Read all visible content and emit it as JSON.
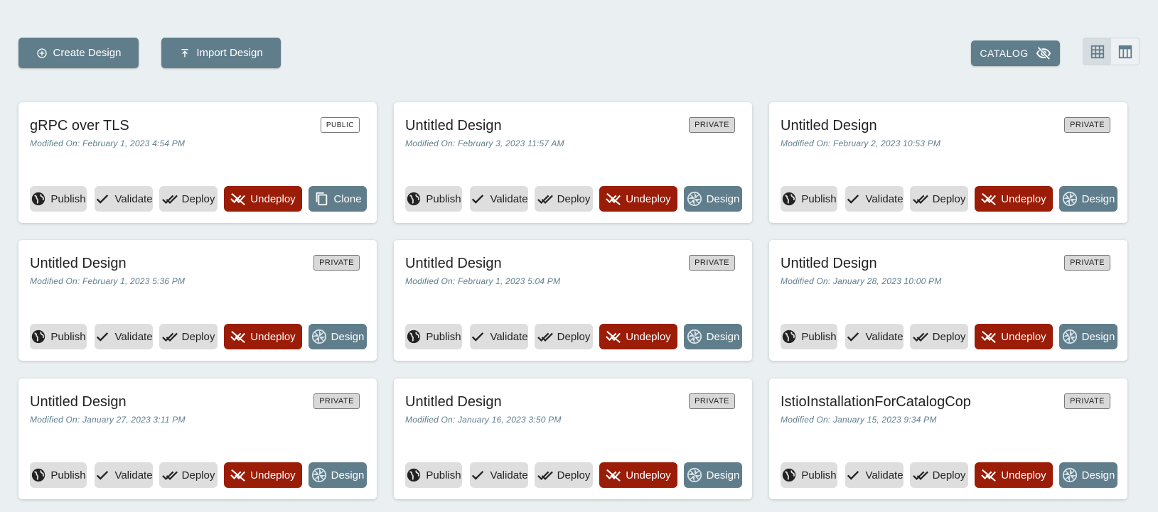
{
  "toolbar": {
    "create_label": "Create Design",
    "import_label": "Import Design",
    "catalog_label": "CATALOG"
  },
  "cards": [
    {
      "title": "gRPC over TLS",
      "modified": "Modified On: February 1, 2023 4:54 PM",
      "badge": "PUBLIC",
      "last_action": "Clone"
    },
    {
      "title": "Untitled Design",
      "modified": "Modified On: February 3, 2023 11:57 AM",
      "badge": "PRIVATE",
      "last_action": "Design"
    },
    {
      "title": "Untitled Design",
      "modified": "Modified On: February 2, 2023 10:53 PM",
      "badge": "PRIVATE",
      "last_action": "Design"
    },
    {
      "title": "Untitled Design",
      "modified": "Modified On: February 1, 2023 5:36 PM",
      "badge": "PRIVATE",
      "last_action": "Design"
    },
    {
      "title": "Untitled Design",
      "modified": "Modified On: February 1, 2023 5:04 PM",
      "badge": "PRIVATE",
      "last_action": "Design"
    },
    {
      "title": "Untitled Design",
      "modified": "Modified On: January 28, 2023 10:00 PM",
      "badge": "PRIVATE",
      "last_action": "Design"
    },
    {
      "title": "Untitled Design",
      "modified": "Modified On: January 27, 2023 3:11 PM",
      "badge": "PRIVATE",
      "last_action": "Design"
    },
    {
      "title": "Untitled Design",
      "modified": "Modified On: January 16, 2023 3:50 PM",
      "badge": "PRIVATE",
      "last_action": "Design"
    },
    {
      "title": "IstioInstallationForCatalogCop",
      "modified": "Modified On: January 15, 2023 9:34 PM",
      "badge": "PRIVATE",
      "last_action": "Design"
    }
  ],
  "actions": {
    "publish": "Publish",
    "validate": "Validate",
    "deploy": "Deploy",
    "undeploy": "Undeploy"
  },
  "colors": {
    "background": "#eaeff2",
    "primary": "#607d8b",
    "undeploy": "#9b1c07",
    "neutral_button": "#dedede"
  },
  "icons": {
    "create": "add-circle-icon",
    "import": "upload-icon",
    "catalog": "visibility-off-icon",
    "grid_view": "grid-view-icon",
    "table_view": "table-view-icon",
    "publish": "globe-icon",
    "validate": "check-icon",
    "deploy": "double-check-icon",
    "undeploy": "remove-done-icon",
    "clone": "copy-icon",
    "design": "meshery-logo-icon"
  }
}
